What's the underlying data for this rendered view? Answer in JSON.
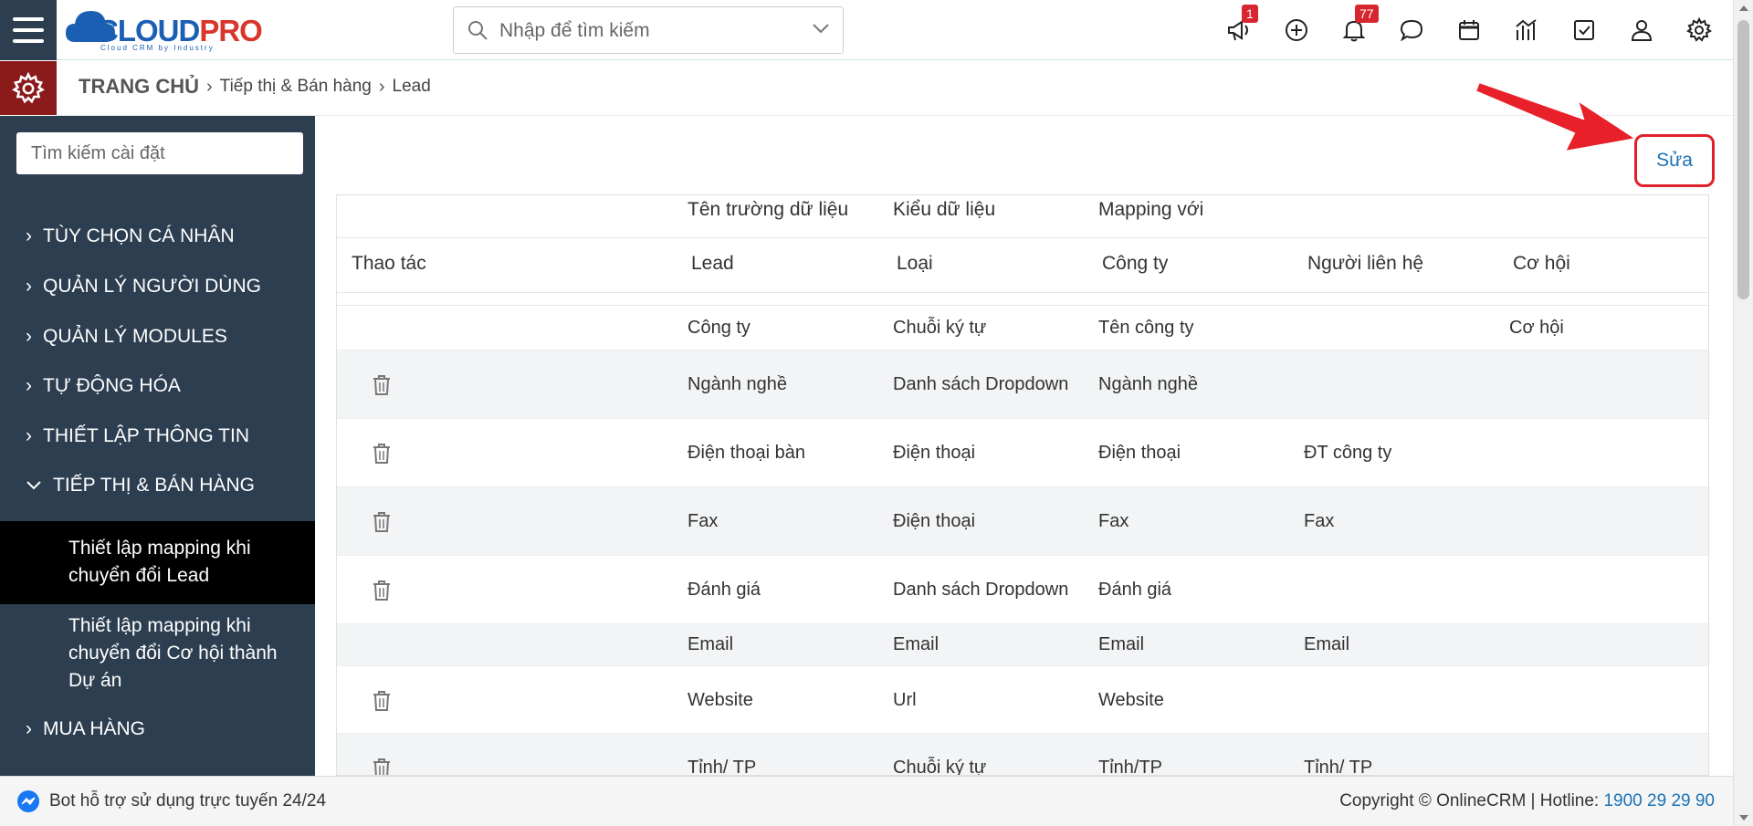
{
  "header": {
    "search_placeholder": "Nhập để tìm kiếm",
    "logo_main": "CLOUD",
    "logo_accent": "PRO",
    "logo_tagline": "Cloud CRM by Industry",
    "badges": {
      "announcements": "1",
      "notifications": "77"
    }
  },
  "breadcrumb": {
    "home": "TRANG CHỦ",
    "section": "Tiếp thị & Bán hàng",
    "page": "Lead"
  },
  "sidebar": {
    "search_placeholder": "Tìm kiếm cài đặt",
    "items": [
      {
        "label": "TÙY CHỌN CÁ NHÂN"
      },
      {
        "label": "QUẢN LÝ NGƯỜI DÙNG"
      },
      {
        "label": "QUẢN LÝ MODULES"
      },
      {
        "label": "TỰ ĐỘNG HÓA"
      },
      {
        "label": "THIẾT LẬP THÔNG TIN"
      },
      {
        "label": "TIẾP THỊ & BÁN HÀNG"
      },
      {
        "label": "MUA HÀNG"
      }
    ],
    "sub_items": [
      {
        "label": "Thiết lập mapping khi chuyển đổi Lead"
      },
      {
        "label": "Thiết lập mapping khi chuyển đổi Cơ hội thành Dự án"
      }
    ]
  },
  "main": {
    "edit_label": "Sửa",
    "table": {
      "group_headers": [
        "Tên trường dữ liệu",
        "Kiểu dữ liệu",
        "Mapping với"
      ],
      "columns": [
        "Thao tác",
        "Lead",
        "Loại",
        "Công ty",
        "Người liên hệ",
        "Cơ hội"
      ],
      "rows": [
        {
          "lead": "Công ty",
          "type": "Chuỗi ký tự",
          "company": "Tên công ty",
          "contact": "",
          "opportunity": "Cơ hội"
        },
        {
          "lead": "Ngành nghề",
          "type": "Danh sách Dropdown",
          "company": "Ngành nghề",
          "contact": "",
          "opportunity": ""
        },
        {
          "lead": "Điện thoại bàn",
          "type": "Điện thoại",
          "company": "Điện thoại",
          "contact": "ĐT công ty",
          "opportunity": ""
        },
        {
          "lead": "Fax",
          "type": "Điện thoại",
          "company": "Fax",
          "contact": "Fax",
          "opportunity": ""
        },
        {
          "lead": "Đánh giá",
          "type": "Danh sách Dropdown",
          "company": "Đánh giá",
          "contact": "",
          "opportunity": ""
        },
        {
          "lead": "Email",
          "type": "Email",
          "company": "Email",
          "contact": "Email",
          "opportunity": ""
        },
        {
          "lead": "Website",
          "type": "Url",
          "company": "Website",
          "contact": "",
          "opportunity": ""
        },
        {
          "lead": "Tỉnh/ TP",
          "type": "Chuỗi ký tự",
          "company": "Tỉnh/TP",
          "contact": "Tỉnh/ TP",
          "opportunity": ""
        }
      ]
    }
  },
  "footer": {
    "chat_text": "Bot hỗ trợ sử dụng trực tuyến 24/24",
    "copyright": "Copyright © OnlineCRM",
    "hotline_label": "Hotline:",
    "hotline_number": "1900 29 29 90"
  },
  "colors": {
    "sidebar_bg": "#2c3e50",
    "gear_box_bg": "#8b1a1a",
    "badge": "#d7262f",
    "link": "#1a73b8",
    "highlight_border": "#e0202a"
  },
  "icons": [
    "hamburger-icon",
    "search-icon",
    "chevron-down-icon",
    "megaphone-icon",
    "plus-circle-icon",
    "bell-icon",
    "chat-icon",
    "calendar-icon",
    "chart-icon",
    "task-icon",
    "user-icon",
    "gear-icon",
    "trash-icon",
    "messenger-icon"
  ]
}
